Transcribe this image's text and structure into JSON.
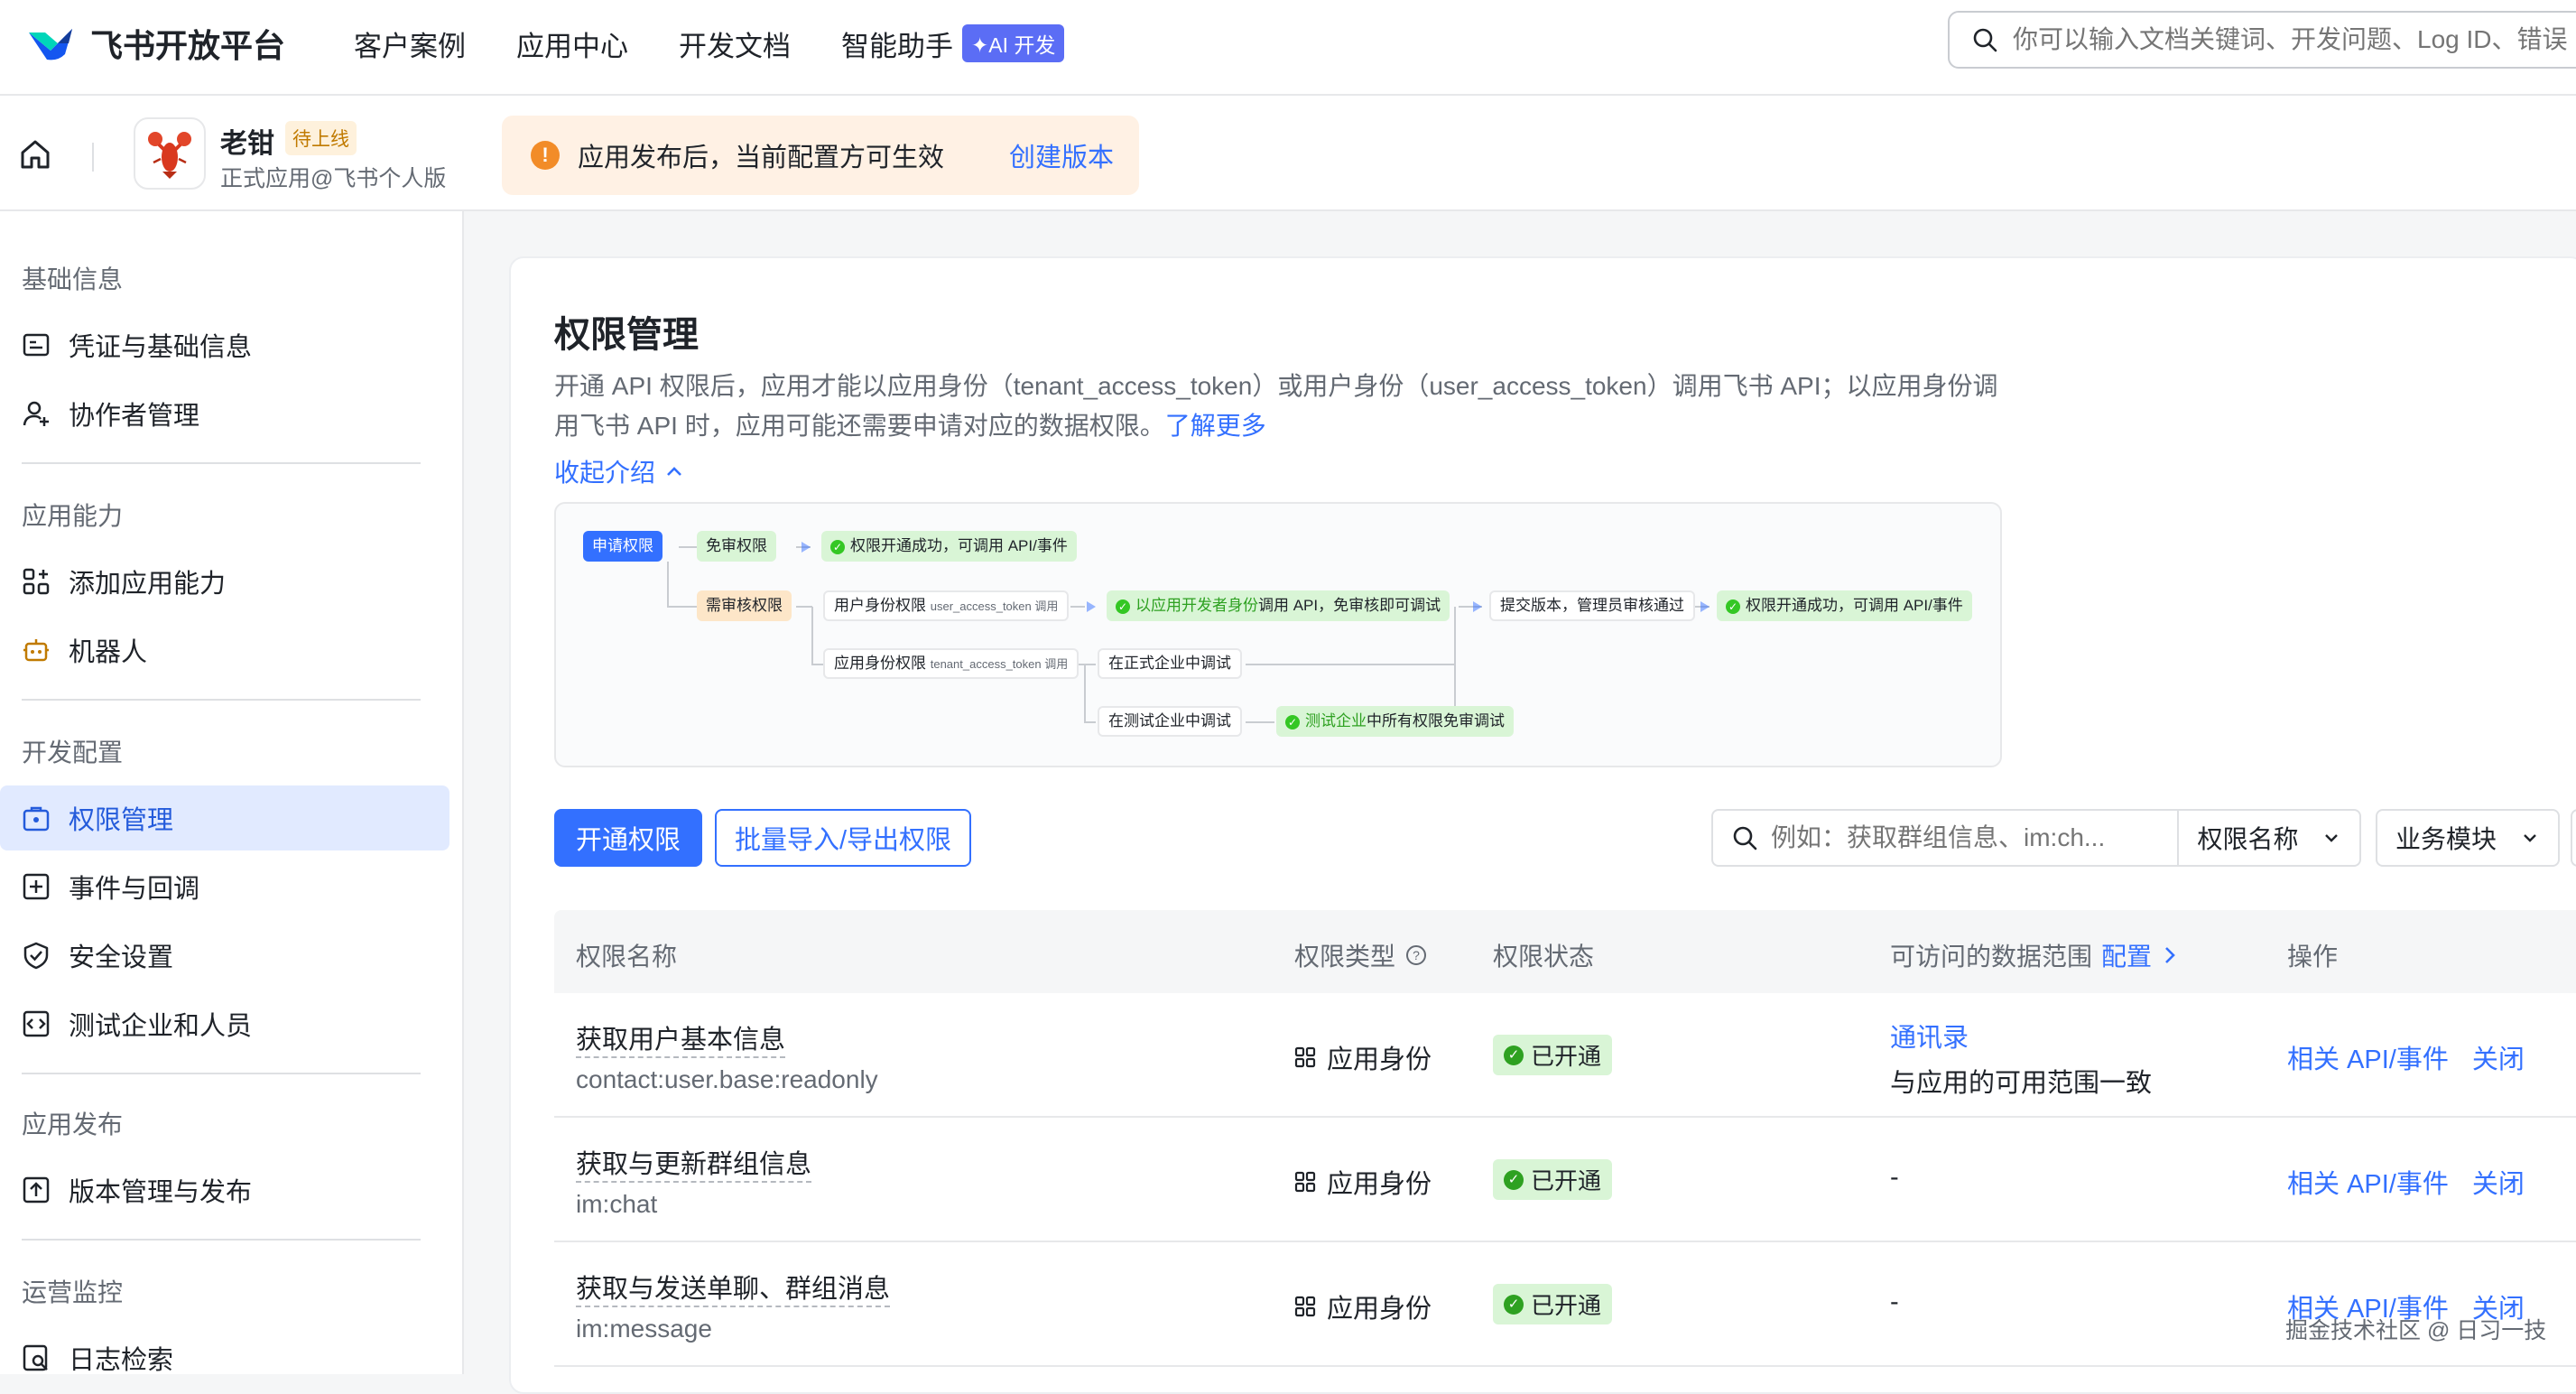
{
  "header": {
    "logo_text": "飞书开放平台",
    "nav": [
      {
        "label": "客户案例"
      },
      {
        "label": "应用中心"
      },
      {
        "label": "开发文档"
      },
      {
        "label": "智能助手",
        "badge": "✦AI 开发"
      }
    ],
    "search_placeholder": "你可以输入文档关键词、开发问题、Log ID、错误"
  },
  "app": {
    "name": "老钳",
    "status": "待上线",
    "subtitle": "正式应用@飞书个人版"
  },
  "notice": {
    "text": "应用发布后，当前配置方可生效",
    "link": "创建版本"
  },
  "sidebar": {
    "groups": [
      {
        "title": "基础信息",
        "items": [
          {
            "label": "凭证与基础信息",
            "icon": "credential-icon"
          },
          {
            "label": "协作者管理",
            "icon": "user-add-icon"
          }
        ]
      },
      {
        "title": "应用能力",
        "items": [
          {
            "label": "添加应用能力",
            "icon": "apps-add-icon"
          },
          {
            "label": "机器人",
            "icon": "robot-icon"
          }
        ]
      },
      {
        "title": "开发配置",
        "items": [
          {
            "label": "权限管理",
            "icon": "permission-icon",
            "active": true
          },
          {
            "label": "事件与回调",
            "icon": "event-icon"
          },
          {
            "label": "安全设置",
            "icon": "shield-icon"
          },
          {
            "label": "测试企业和人员",
            "icon": "test-icon"
          }
        ]
      },
      {
        "title": "应用发布",
        "items": [
          {
            "label": "版本管理与发布",
            "icon": "upload-icon"
          }
        ]
      },
      {
        "title": "运营监控",
        "items": [
          {
            "label": "日志检索",
            "icon": "log-search-icon"
          }
        ]
      }
    ]
  },
  "main": {
    "title": "权限管理",
    "intro": "开通 API 权限后，应用才能以应用身份（tenant_access_token）或用户身份（user_access_token）调用飞书 API；以应用身份调用飞书 API 时，应用可能还需要申请对应的数据权限。",
    "intro_link": "了解更多",
    "collapse": "收起介绍",
    "flow": {
      "apply": "申请权限",
      "no_review": "免审权限",
      "success1": "权限开通成功，可调用 API/事件",
      "need_review": "需审核权限",
      "user_perm": "用户身份权限",
      "user_perm_small": "user_access_token 调用",
      "dev_debug_pre": "以应用开发者身份",
      "dev_debug": "调用 API，免审核即可调试",
      "submit": "提交版本，管理员审核通过",
      "success2": "权限开通成功，可调用 API/事件",
      "app_perm": "应用身份权限",
      "app_perm_small": "tenant_access_token 调用",
      "formal_debug": "在正式企业中调试",
      "test_debug": "在测试企业中调试",
      "test_all_pre": "测试企业",
      "test_all": "中所有权限免审调试"
    },
    "btn_open": "开通权限",
    "btn_batch": "批量导入/导出权限",
    "filter_placeholder": "例如：获取群组信息、im:ch...",
    "filter_select": "权限名称",
    "module_select": "业务模块",
    "columns": {
      "name": "权限名称",
      "type": "权限类型",
      "status": "权限状态",
      "scope": "可访问的数据范围",
      "scope_link": "配置",
      "ops": "操作"
    },
    "rows": [
      {
        "name": "获取用户基本信息",
        "code": "contact:user.base:readonly",
        "type": "应用身份",
        "status": "已开通",
        "scope_link": "通讯录",
        "scope_text": "与应用的可用范围一致",
        "op1": "相关 API/事件",
        "op2": "关闭"
      },
      {
        "name": "获取与更新群组信息",
        "code": "im:chat",
        "type": "应用身份",
        "status": "已开通",
        "scope_text": "-",
        "op1": "相关 API/事件",
        "op2": "关闭"
      },
      {
        "name": "获取与发送单聊、群组消息",
        "code": "im:message",
        "type": "应用身份",
        "status": "已开通",
        "scope_text": "-",
        "op1": "相关 API/事件",
        "op2": "关闭"
      }
    ]
  },
  "watermark": "掘金技术社区 @ 日习一技"
}
